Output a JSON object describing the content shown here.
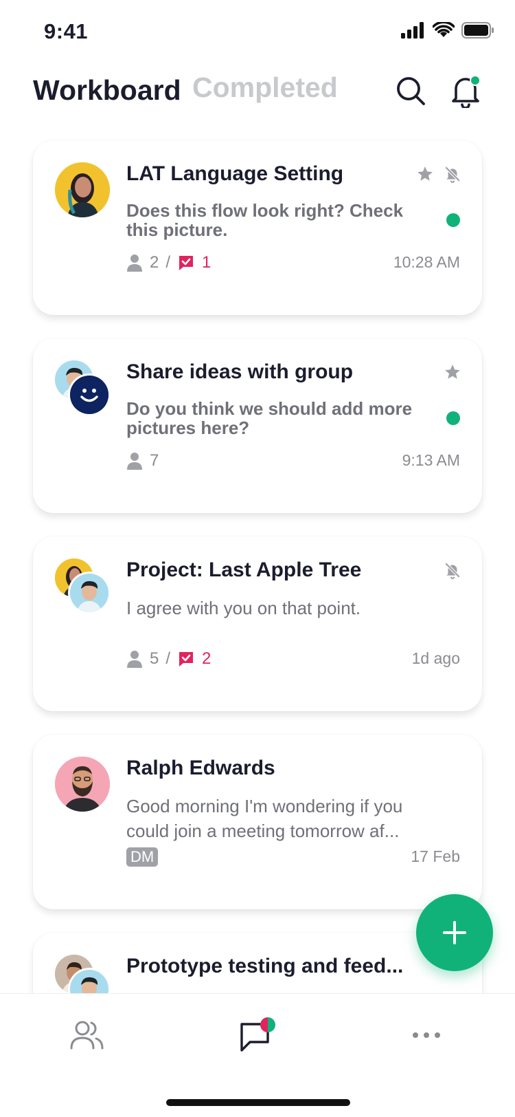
{
  "status": {
    "time": "9:41"
  },
  "header": {
    "active_tab": "Workboard",
    "inactive_tab": "Completed"
  },
  "cards": [
    {
      "title": "LAT Language Setting",
      "message": "Does this flow look right? Check this picture.",
      "members": "2",
      "separator": "/",
      "tasks": "1",
      "time": "10:28 AM"
    },
    {
      "title": "Share ideas with group",
      "message": "Do you think we should add more pictures here?",
      "members": "7",
      "time": "9:13 AM"
    },
    {
      "title": "Project: Last Apple Tree",
      "message": "I agree with you on that point.",
      "members": "5",
      "separator": "/",
      "tasks": "2",
      "time": "1d ago"
    },
    {
      "title": "Ralph Edwards",
      "message": "Good morning I'm wondering if you could join a meeting tomorrow af...",
      "badge": "DM",
      "time": "17 Feb"
    },
    {
      "title": "Prototype testing and feed..."
    }
  ],
  "colors": {
    "accent": "#10b27a",
    "alert": "#e0245e",
    "text": "#1b1d2e",
    "muted": "#8a8b90"
  },
  "icons": [
    "search-icon",
    "bell-icon",
    "star-icon",
    "bell-off-icon",
    "person-icon",
    "task-icon",
    "plus-icon",
    "people-icon",
    "chat-icon",
    "more-icon"
  ]
}
